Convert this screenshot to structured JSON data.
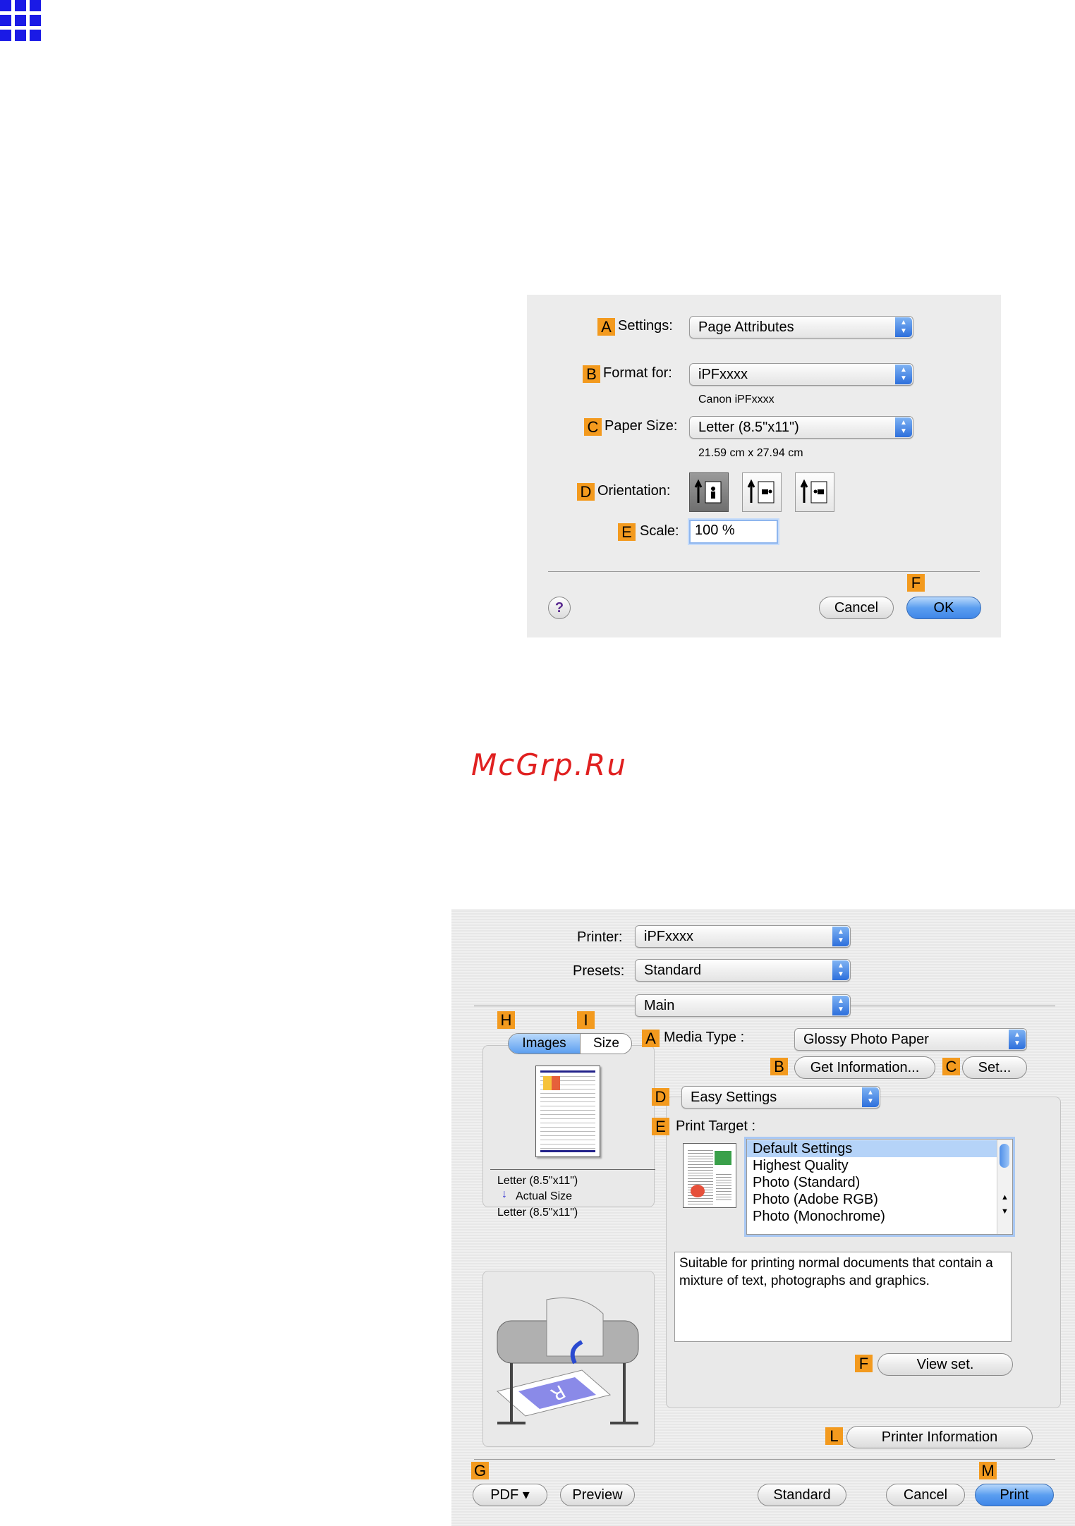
{
  "watermark": "McGrp.Ru",
  "page_setup": {
    "settings": {
      "badge": "A",
      "label": "Settings:",
      "value": "Page Attributes"
    },
    "format_for": {
      "badge": "B",
      "label": "Format for:",
      "value": "iPFxxxx",
      "sub": "Canon iPFxxxx"
    },
    "paper_size": {
      "badge": "C",
      "label": "Paper Size:",
      "value": "Letter (8.5\"x11\")",
      "sub": "21.59 cm x 27.94 cm"
    },
    "orientation": {
      "badge": "D",
      "label": "Orientation:"
    },
    "scale": {
      "badge": "E",
      "label": "Scale:",
      "value": "100 %"
    },
    "help_label": "?",
    "cancel_label": "Cancel",
    "ok_badge": "F",
    "ok_label": "OK"
  },
  "print_dialog": {
    "printer": {
      "label": "Printer:",
      "value": "iPFxxxx"
    },
    "presets": {
      "label": "Presets:",
      "value": "Standard"
    },
    "pane": {
      "value": "Main"
    },
    "tabs": {
      "images_badge": "H",
      "size_badge": "I",
      "images_label": "Images",
      "size_label": "Size"
    },
    "preview_info": {
      "line1": "Letter (8.5\"x11\")",
      "line2": "Actual Size",
      "line3": "Letter (8.5\"x11\")"
    },
    "media_type": {
      "badge": "A",
      "label": "Media Type :",
      "value": "Glossy Photo Paper"
    },
    "get_info": {
      "badge": "B",
      "label": "Get Information..."
    },
    "set": {
      "badge": "C",
      "label": "Set..."
    },
    "easy_settings": {
      "badge": "D",
      "value": "Easy Settings"
    },
    "print_target": {
      "badge": "E",
      "label": "Print Target :",
      "items": [
        "Default Settings",
        "Highest Quality",
        "Photo (Standard)",
        "Photo (Adobe RGB)",
        "Photo (Monochrome)"
      ],
      "selected": "Default Settings"
    },
    "description": "Suitable for printing normal documents that contain a mixture of text, photographs and graphics.",
    "view_set": {
      "badge": "F",
      "label": "View set."
    },
    "printer_info": {
      "badge": "L",
      "label": "Printer Information"
    },
    "pdf": {
      "badge": "G",
      "label": "PDF ▾"
    },
    "preview_label": "Preview",
    "standard_label": "Standard",
    "cancel_label": "Cancel",
    "print": {
      "badge": "M",
      "label": "Print"
    }
  }
}
